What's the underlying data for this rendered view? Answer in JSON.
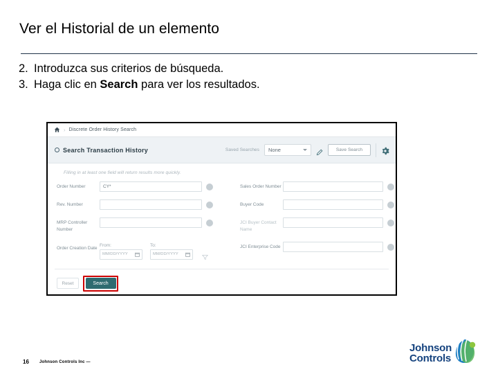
{
  "slide": {
    "title": "Ver el Historial de un elemento",
    "steps": [
      {
        "num": "2.",
        "text_before": "Introduzca sus criterios de búsqueda.",
        "bold": "",
        "text_after": ""
      },
      {
        "num": "3.",
        "text_before": "Haga clic en ",
        "bold": "Search",
        "text_after": " para ver los resultados."
      }
    ]
  },
  "app": {
    "breadcrumb": {
      "home_icon": "home-icon",
      "separator": "›",
      "label": "Discrete Order History Search"
    },
    "toolbar": {
      "status_icon": "circle-icon",
      "title": "Search Transaction History",
      "saved_searches_label": "Saved Searches",
      "saved_searches_value": "None",
      "edit_icon": "pencil-icon",
      "save_search_label": "Save Search",
      "settings_icon": "gear-icon"
    },
    "hint": "Filling in at least one field will return results more quickly.",
    "form": {
      "left_fields": [
        {
          "label": "Order Number",
          "value": "CY*",
          "muted": false
        },
        {
          "label": "Rev. Number",
          "value": "",
          "muted": false
        },
        {
          "label": "MRP Controller Number",
          "value": "",
          "muted": false
        }
      ],
      "right_fields": [
        {
          "label": "Sales Order Number",
          "value": "",
          "muted": false
        },
        {
          "label": "Buyer Code",
          "value": "",
          "muted": false
        },
        {
          "label": "JCI Buyer Contact Name",
          "value": "",
          "muted": true
        },
        {
          "label": "JCI Enterprise Code",
          "value": "",
          "muted": false
        }
      ],
      "date_row": {
        "label": "Order Creation Date",
        "from_label": "From:",
        "to_label": "To:",
        "from_placeholder": "MM/DD/YYYY",
        "to_placeholder": "MM/DD/YYYY",
        "calendar_icon": "calendar-icon",
        "filter_icon": "funnel-icon"
      }
    },
    "actions": {
      "reset_label": "Reset",
      "search_label": "Search",
      "highlight_color": "#cc0000",
      "search_color": "#2e6b70"
    }
  },
  "footer": {
    "page_number": "16",
    "company": "Johnson Controls Inc —",
    "logo_line1": "Johnson",
    "logo_line2": "Controls",
    "logo_color": "#14427e"
  }
}
